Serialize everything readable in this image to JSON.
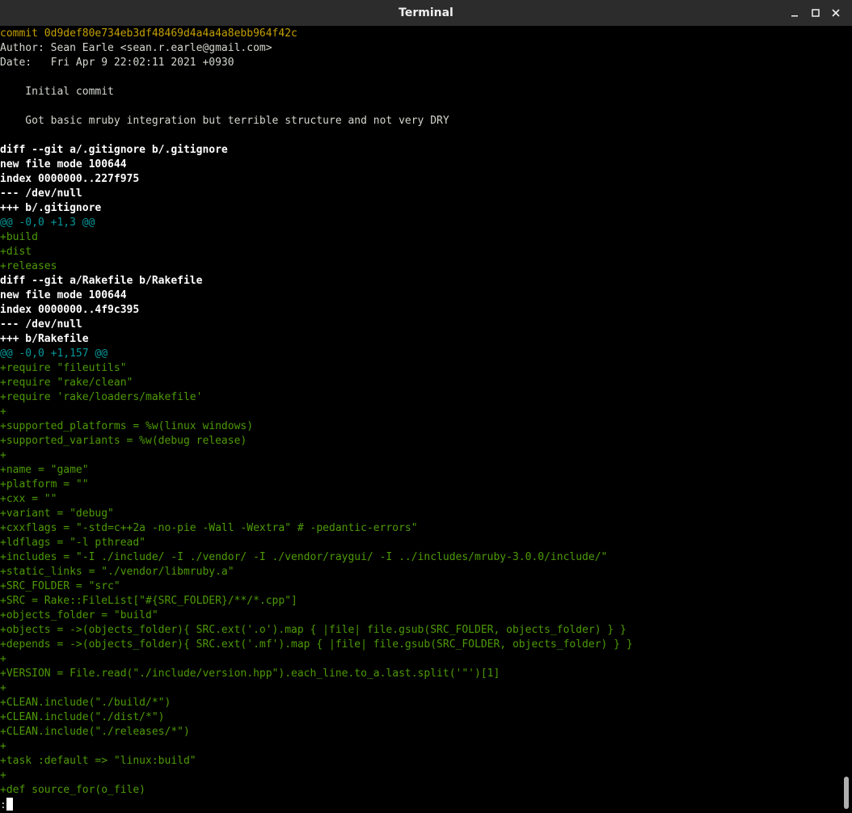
{
  "window": {
    "title": "Terminal"
  },
  "controls": {
    "minimize_icon": "minimize-icon",
    "maximize_icon": "maximize-icon",
    "close_icon": "close-icon"
  },
  "terminal": {
    "prompt": ":",
    "lines": [
      {
        "text": "commit 0d9def80e734eb3df48469d4a4a4a8ebb964f42c",
        "style": "yellow"
      },
      {
        "text": "Author: Sean Earle <sean.r.earle@gmail.com>",
        "style": "plain"
      },
      {
        "text": "Date:   Fri Apr 9 22:02:11 2021 +0930",
        "style": "plain"
      },
      {
        "text": "",
        "style": "plain"
      },
      {
        "text": "    Initial commit",
        "style": "plain"
      },
      {
        "text": "",
        "style": "plain"
      },
      {
        "text": "    Got basic mruby integration but terrible structure and not very DRY",
        "style": "plain"
      },
      {
        "text": "",
        "style": "plain"
      },
      {
        "text": "diff --git a/.gitignore b/.gitignore",
        "style": "bold"
      },
      {
        "text": "new file mode 100644",
        "style": "bold"
      },
      {
        "text": "index 0000000..227f975",
        "style": "bold"
      },
      {
        "text": "--- /dev/null",
        "style": "bold"
      },
      {
        "text": "+++ b/.gitignore",
        "style": "bold"
      },
      {
        "text": "@@ -0,0 +1,3 @@",
        "style": "cyan"
      },
      {
        "text": "+build",
        "style": "green"
      },
      {
        "text": "+dist",
        "style": "green"
      },
      {
        "text": "+releases",
        "style": "green"
      },
      {
        "text": "diff --git a/Rakefile b/Rakefile",
        "style": "bold"
      },
      {
        "text": "new file mode 100644",
        "style": "bold"
      },
      {
        "text": "index 0000000..4f9c395",
        "style": "bold"
      },
      {
        "text": "--- /dev/null",
        "style": "bold"
      },
      {
        "text": "+++ b/Rakefile",
        "style": "bold"
      },
      {
        "text": "@@ -0,0 +1,157 @@",
        "style": "cyan"
      },
      {
        "text": "+require \"fileutils\"",
        "style": "green"
      },
      {
        "text": "+require \"rake/clean\"",
        "style": "green"
      },
      {
        "text": "+require 'rake/loaders/makefile'",
        "style": "green"
      },
      {
        "text": "+",
        "style": "green"
      },
      {
        "text": "+supported_platforms = %w(linux windows)",
        "style": "green"
      },
      {
        "text": "+supported_variants = %w(debug release)",
        "style": "green"
      },
      {
        "text": "+",
        "style": "green"
      },
      {
        "text": "+name = \"game\"",
        "style": "green"
      },
      {
        "text": "+platform = \"\"",
        "style": "green"
      },
      {
        "text": "+cxx = \"\"",
        "style": "green"
      },
      {
        "text": "+variant = \"debug\"",
        "style": "green"
      },
      {
        "text": "+cxxflags = \"-std=c++2a -no-pie -Wall -Wextra\" # -pedantic-errors\"",
        "style": "green"
      },
      {
        "text": "+ldflags = \"-l pthread\"",
        "style": "green"
      },
      {
        "text": "+includes = \"-I ./include/ -I ./vendor/ -I ./vendor/raygui/ -I ../includes/mruby-3.0.0/include/\"",
        "style": "green"
      },
      {
        "text": "+static_links = \"./vendor/libmruby.a\"",
        "style": "green"
      },
      {
        "text": "+SRC_FOLDER = \"src\"",
        "style": "green"
      },
      {
        "text": "+SRC = Rake::FileList[\"#{SRC_FOLDER}/**/*.cpp\"]",
        "style": "green"
      },
      {
        "text": "+objects_folder = \"build\"",
        "style": "green"
      },
      {
        "text": "+objects = ->(objects_folder){ SRC.ext('.o').map { |file| file.gsub(SRC_FOLDER, objects_folder) } }",
        "style": "green"
      },
      {
        "text": "+depends = ->(objects_folder){ SRC.ext('.mf').map { |file| file.gsub(SRC_FOLDER, objects_folder) } }",
        "style": "green"
      },
      {
        "text": "+",
        "style": "green"
      },
      {
        "text": "+VERSION = File.read(\"./include/version.hpp\").each_line.to_a.last.split('\"')[1]",
        "style": "green"
      },
      {
        "text": "+",
        "style": "green"
      },
      {
        "text": "+CLEAN.include(\"./build/*\")",
        "style": "green"
      },
      {
        "text": "+CLEAN.include(\"./dist/*\")",
        "style": "green"
      },
      {
        "text": "+CLEAN.include(\"./releases/*\")",
        "style": "green"
      },
      {
        "text": "+",
        "style": "green"
      },
      {
        "text": "+task :default => \"linux:build\"",
        "style": "green"
      },
      {
        "text": "+",
        "style": "green"
      },
      {
        "text": "+def source_for(o_file)",
        "style": "green"
      }
    ]
  }
}
